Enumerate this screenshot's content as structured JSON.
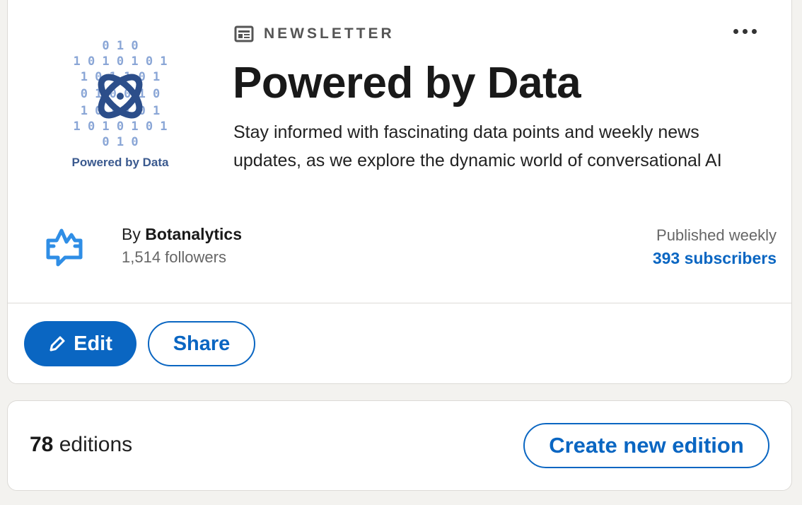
{
  "newsletter": {
    "kicker_label": "NEWSLETTER",
    "kicker_icon": "newspaper-icon",
    "title": "Powered by Data",
    "description": "Stay informed with fascinating data points and weekly news updates, as we explore the dynamic world of conversational AI",
    "logo_caption": "Powered by Data",
    "more_icon": "more-horizontal-icon"
  },
  "author": {
    "by_prefix": "By",
    "name": "Botanalytics",
    "followers": "1,514 followers",
    "logo_icon": "botanalytics-chat-icon"
  },
  "publication": {
    "frequency": "Published weekly",
    "subscribers": "393 subscribers"
  },
  "actions": {
    "edit_label": "Edit",
    "edit_icon": "pencil-icon",
    "share_label": "Share"
  },
  "editions": {
    "count": "78",
    "count_suffix": "editions",
    "create_label": "Create new edition"
  },
  "colors": {
    "accent": "#0a66c2",
    "page_background": "#f3f2ef",
    "logo_primary": "#2c4e8a"
  }
}
